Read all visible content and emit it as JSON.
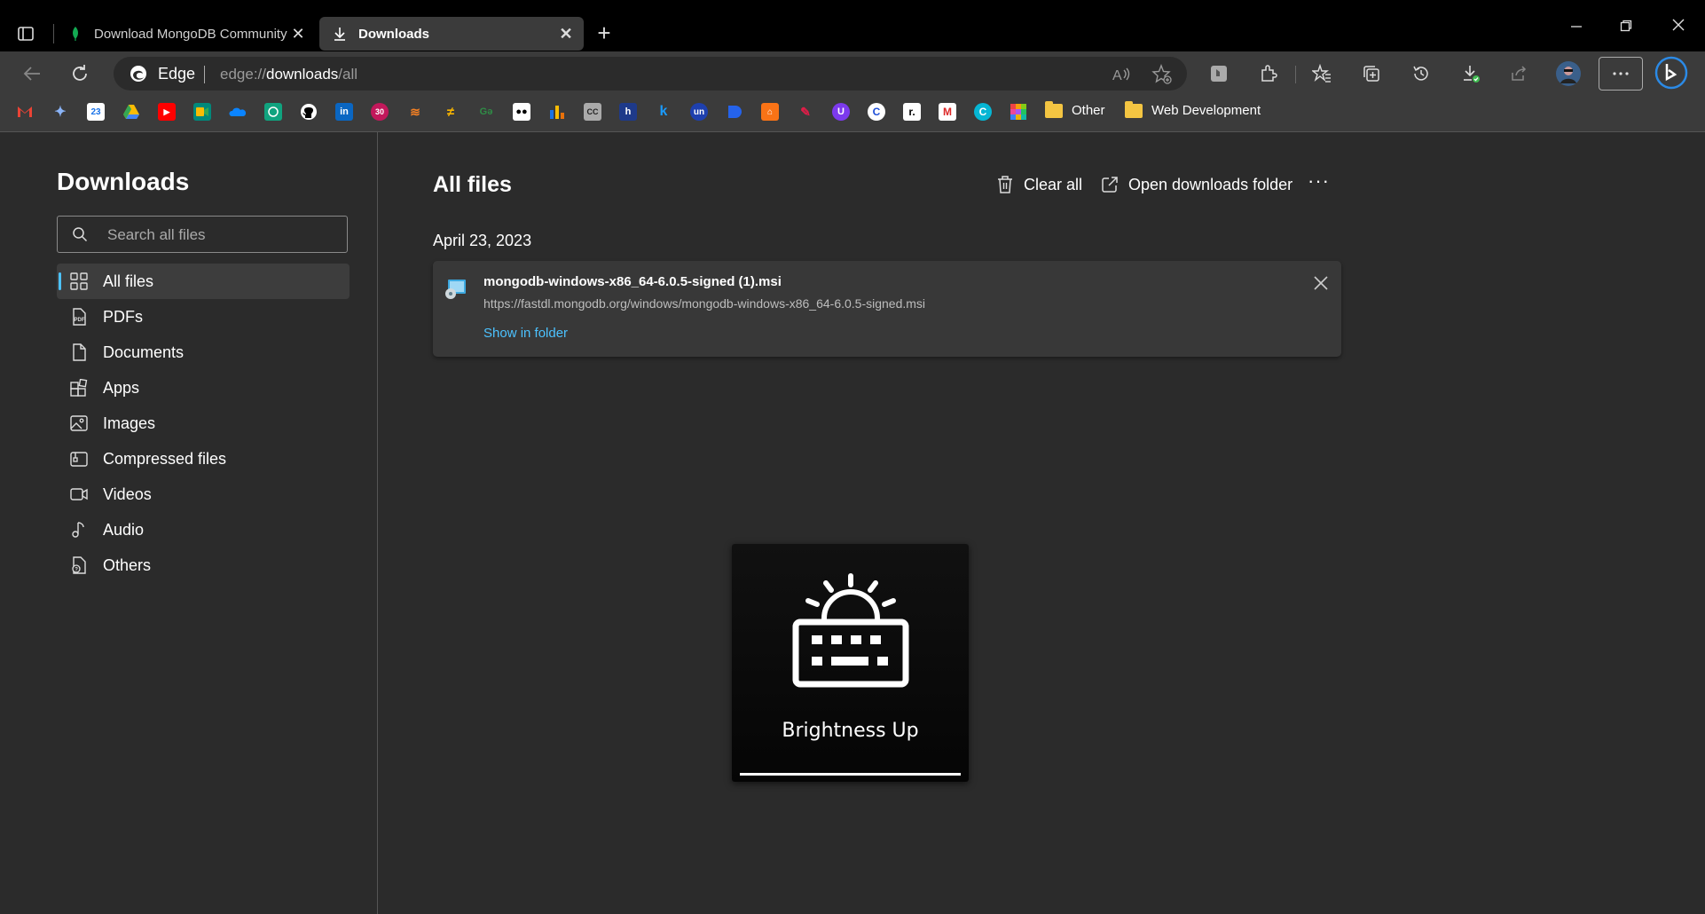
{
  "tabs": [
    {
      "label": "Download MongoDB Community",
      "icon": "mongodb-leaf-icon",
      "active": false
    },
    {
      "label": "Downloads",
      "icon": "download-icon",
      "active": true
    }
  ],
  "addressbar": {
    "browser_label": "Edge",
    "url_prefix": "edge://",
    "url_host": "downloads",
    "url_path": "/all"
  },
  "bookmarks": {
    "folders": [
      "Other",
      "Web Development"
    ]
  },
  "sidebar": {
    "title": "Downloads",
    "search_placeholder": "Search all files",
    "items": [
      {
        "label": "All files",
        "icon": "grid-icon",
        "active": true
      },
      {
        "label": "PDFs",
        "icon": "pdf-icon"
      },
      {
        "label": "Documents",
        "icon": "document-icon"
      },
      {
        "label": "Apps",
        "icon": "apps-icon"
      },
      {
        "label": "Images",
        "icon": "image-icon"
      },
      {
        "label": "Compressed files",
        "icon": "compressed-icon"
      },
      {
        "label": "Videos",
        "icon": "video-icon"
      },
      {
        "label": "Audio",
        "icon": "audio-icon"
      },
      {
        "label": "Others",
        "icon": "others-icon"
      }
    ]
  },
  "main": {
    "title": "All files",
    "clear_all": "Clear all",
    "open_folder": "Open downloads folder",
    "groups": [
      {
        "date": "April 23, 2023",
        "items": [
          {
            "filename": "mongodb-windows-x86_64-6.0.5-signed (1).msi",
            "url": "https://fastdl.mongodb.org/windows/mongodb-windows-x86_64-6.0.5-signed.msi",
            "action": "Show in folder"
          }
        ]
      }
    ]
  },
  "osd": {
    "label": "Brightness Up",
    "level_fraction": 1.0
  },
  "colors": {
    "accent": "#4cc2ff",
    "background": "#2b2b2b",
    "toolbar": "#3b3b3b"
  }
}
